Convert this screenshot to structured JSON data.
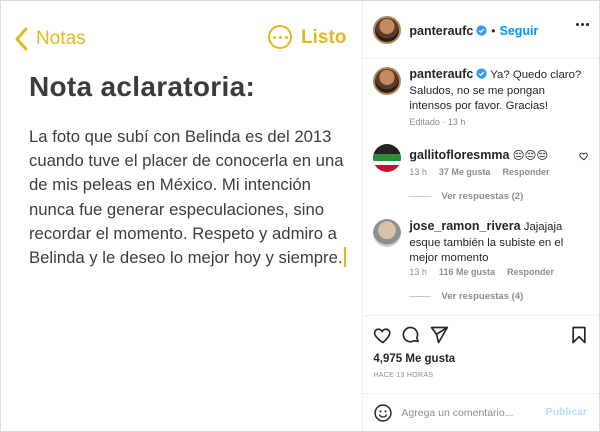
{
  "notes": {
    "back_label": "Notas",
    "done_label": "Listo",
    "title": "Nota aclaratoria:",
    "body": "La foto que subí con Belinda es del 2013 cuando tuve el placer de conocerla en una de mis peleas en México. Mi intención nunca fue generar especulaciones, sino recordar el momento. Respeto y admiro a Belinda y le deseo lo mejor hoy y siempre."
  },
  "header": {
    "username": "panteraufc",
    "separator": "•",
    "follow_label": "Seguir"
  },
  "caption": {
    "username": "panteraufc",
    "text": "Ya? Quedo claro? Saludos, no se me pongan intensos por favor. Gracias!",
    "meta": "Editado · 13 h"
  },
  "comments": [
    {
      "username": "gallitofloresmma",
      "text": "😔😔😔",
      "time": "13 h",
      "likes": "37 Me gusta",
      "reply_label": "Responder",
      "view_replies": "Ver respuestas (2)"
    },
    {
      "username": "jose_ramon_rivera",
      "text": "Jajajaja esque también la subiste en el mejor momento",
      "time": "13 h",
      "likes": "116 Me gusta",
      "reply_label": "Responder",
      "view_replies": "Ver respuestas (4)"
    }
  ],
  "post": {
    "likes": "4,975 Me gusta",
    "time_ago": "HACE 13 HORAS"
  },
  "add_comment": {
    "placeholder": "Agrega un comentario...",
    "publish_label": "Publicar"
  },
  "colors": {
    "notes_accent": "#e2b91e",
    "ig_blue": "#0095f6",
    "publish_disabled": "#b2dffc",
    "muted": "#8e8e8e"
  },
  "icons": [
    "chevron-left-icon",
    "more-circle-icon",
    "verified-icon",
    "more-icon",
    "heart-icon",
    "comment-icon",
    "share-icon",
    "bookmark-icon",
    "emoji-icon"
  ]
}
